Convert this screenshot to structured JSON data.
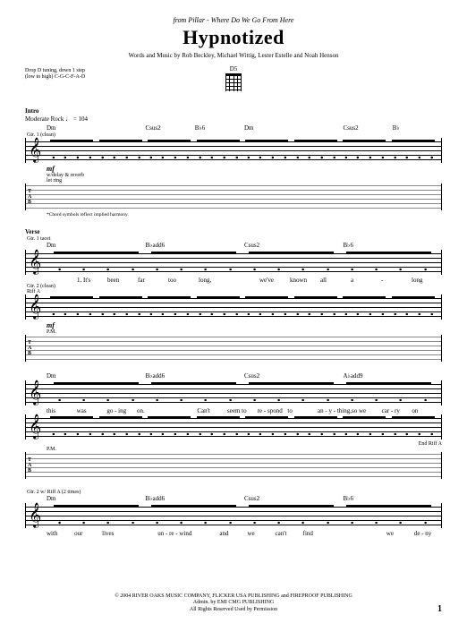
{
  "header": {
    "from_prefix": "from",
    "artist": "Pillar",
    "album_sep": " - ",
    "album": "Where Do We Go From Here",
    "title": "Hypnotized",
    "credits": "Words and Music by Rob Beckley, Michael Wittig, Lester Estelle and Noah Henson",
    "chord_diagram_name": "D5"
  },
  "tuning": {
    "line1": "Drop D tuning, down 1 step",
    "line2": "(low to high) C-G-C-F-A-D"
  },
  "intro": {
    "section": "Intro",
    "tempo": "Moderate Rock ♩ = 104",
    "chords": [
      "Dm",
      "",
      "Csus2",
      "B♭6",
      "Dm",
      "",
      "Csus2",
      "B♭"
    ],
    "gtr": "Gtr. 1 (clean)",
    "dynamic": "mf",
    "perf": "w/delay & reverb",
    "perf2": "let ring",
    "footnote": "*Chord symbols reflect implied harmony."
  },
  "verse": {
    "section": "Verse",
    "gtr1": "Gtr. 1 tacet",
    "sys1": {
      "chords": [
        "Dm",
        "",
        "B♭add6",
        "",
        "Csus2",
        "",
        "B♭6",
        ""
      ],
      "lyrics": [
        "",
        "1. It's",
        "been",
        "far",
        "too",
        "long,",
        "",
        "we've",
        "known",
        "all",
        "a",
        "-",
        "long"
      ]
    },
    "gtr2": "Gtr. 2 (clean)",
    "riffA": "Riff A",
    "dynamic": "mf",
    "perf": "P.M.",
    "sys2": {
      "chords": [
        "Dm",
        "",
        "B♭add6",
        "",
        "Csus2",
        "",
        "A♭add9",
        ""
      ],
      "lyrics": [
        "this",
        "was",
        "go - ing",
        "on.",
        "",
        "Can't",
        "seem to",
        "re - spond",
        "to",
        "an - y - thing,",
        "so we",
        "car - ry",
        "on"
      ],
      "end_riff": "End Riff A"
    },
    "sys3": {
      "gtr": "Gtr. 2 w/ Riff A (2 times)",
      "chords": [
        "Dm",
        "",
        "B♭add6",
        "",
        "Csus2",
        "",
        "B♭6",
        ""
      ],
      "lyrics": [
        "with",
        "our",
        "lives",
        "",
        "un - re - wind",
        "",
        "and",
        "we",
        "can't",
        "find",
        "",
        "",
        "we",
        "de - ny"
      ]
    }
  },
  "footer": {
    "copyright": "© 2004 RIVER OAKS MUSIC COMPANY, FLICKER USA PUBLISHING and FIREPROOF PUBLISHING",
    "admin": "Admin. by EMI CMG PUBLISHING",
    "rights": "All Rights Reserved   Used by Permission"
  },
  "page": "1",
  "tab_label": {
    "t": "T",
    "a": "A",
    "b": "B"
  }
}
